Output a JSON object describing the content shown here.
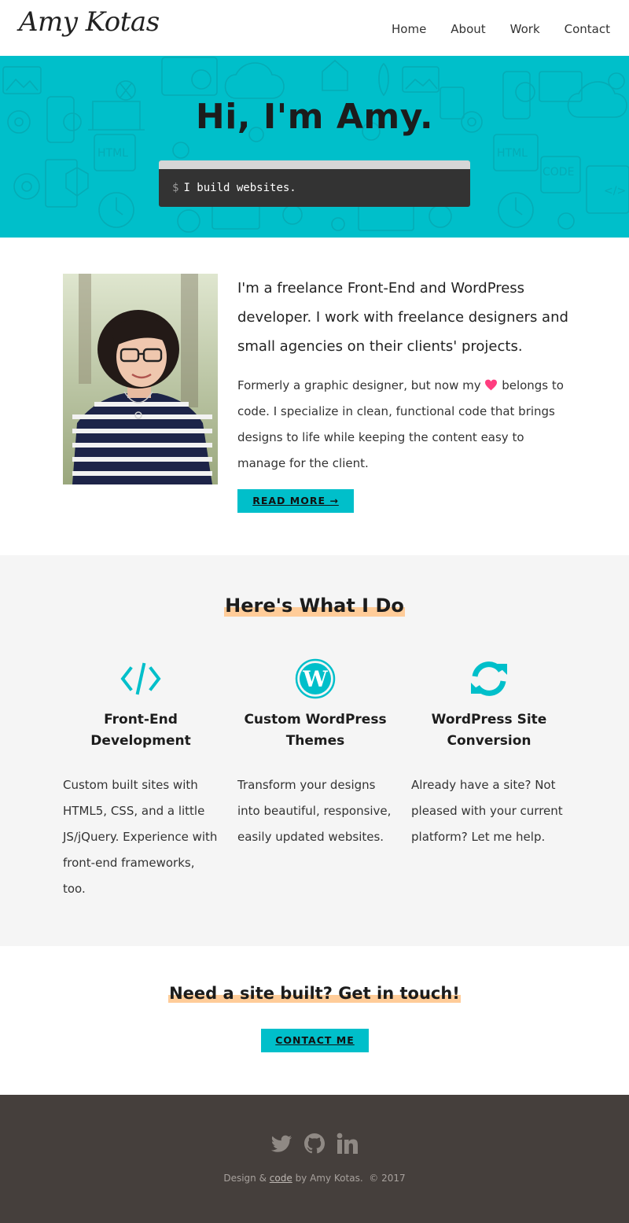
{
  "header": {
    "logo": "Amy Kotas",
    "nav": [
      {
        "label": "Home"
      },
      {
        "label": "About"
      },
      {
        "label": "Work"
      },
      {
        "label": "Contact"
      }
    ]
  },
  "hero": {
    "title": "Hi, I'm Amy.",
    "terminal_prompt": "$",
    "terminal_text": "I build websites."
  },
  "about": {
    "photo_icon": "portrait-photo",
    "lead": "I'm a freelance Front-End and WordPress developer. I work with freelance designers and small agencies on their clients' projects.",
    "body_before": "Formerly a graphic designer, but now my",
    "body_after": "belongs to code. I specialize in clean, functional code that brings designs to life while keeping the content easy to manage for the client.",
    "heart_icon": "heart-icon",
    "read_more": "READ MORE →"
  },
  "services": {
    "title": "Here's What I Do",
    "items": [
      {
        "icon": "code-icon",
        "title": "Front-End Development",
        "text": "Custom built sites with HTML5, CSS, and a little JS/jQuery. Experience with front-end frameworks, too."
      },
      {
        "icon": "wordpress-icon",
        "title": "Custom WordPress Themes",
        "text": "Transform your designs into beautiful, responsive, easily updated websites."
      },
      {
        "icon": "refresh-icon",
        "title": "WordPress Site Conversion",
        "text": "Already have a site? Not pleased with your current platform? Let me help."
      }
    ]
  },
  "cta": {
    "title": "Need a site built? Get in touch!",
    "button": "CONTACT ME"
  },
  "footer": {
    "social": [
      "twitter-icon",
      "github-icon",
      "linkedin-icon"
    ],
    "text_before": "Design &",
    "code_link": "code",
    "text_after": "by Amy Kotas.",
    "copyright": "© 2017"
  },
  "colors": {
    "accent": "#00bfca",
    "highlight": "#ffcc99",
    "footer_bg": "#453f3c",
    "services_bg": "#f5f5f5",
    "heart": "#ff3d7f"
  }
}
